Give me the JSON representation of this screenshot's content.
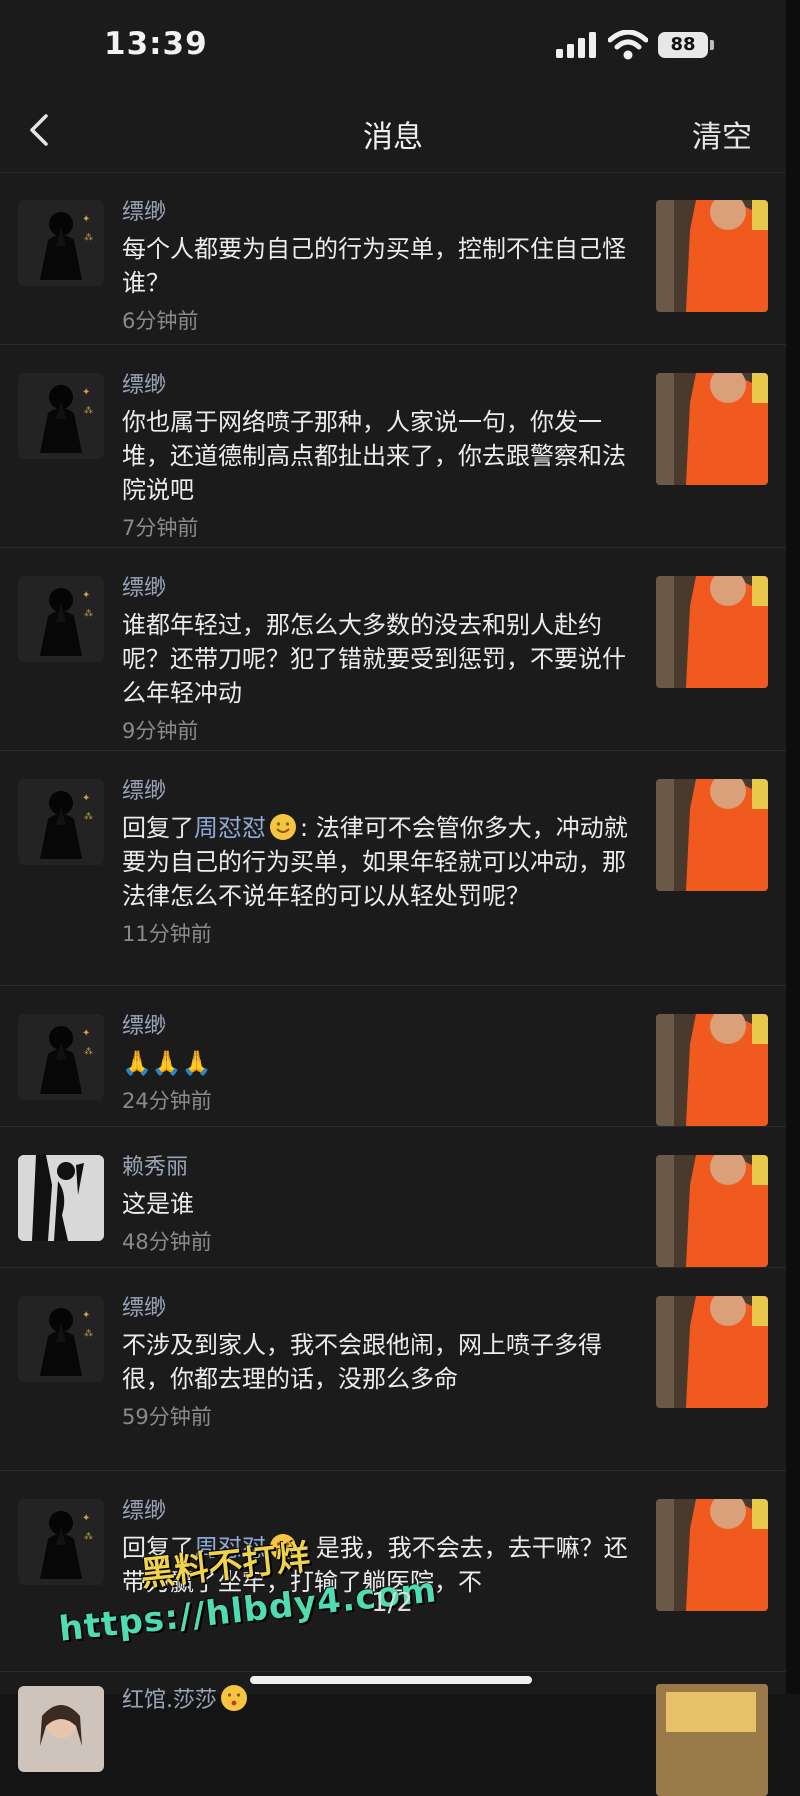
{
  "status_bar": {
    "time": "13:39",
    "battery": "88"
  },
  "nav": {
    "title": "消息",
    "clear_label": "清空"
  },
  "messages": [
    {
      "name": "缥缈",
      "text": "每个人都要为自己的行为买单，控制不住自己怪谁？",
      "time": "6分钟前",
      "avatar": "praying-hands-avatar"
    },
    {
      "name": "缥缈",
      "text": "你也属于网络喷子那种，人家说一句，你发一堆，还道德制高点都扯出来了，你去跟警察和法院说吧",
      "time": "7分钟前",
      "avatar": "praying-hands-avatar"
    },
    {
      "name": "缥缈",
      "text": "谁都年轻过，那怎么大多数的没去和别人赴约呢？还带刀呢？犯了错就要受到惩罚，不要说什么年轻冲动",
      "time": "9分钟前",
      "avatar": "praying-hands-avatar"
    },
    {
      "name": "缥缈",
      "reply_prefix": "回复了",
      "reply_to": "周怼怼",
      "text": ": 法律可不会管你多大，冲动就要为自己的行为买单，如果年轻就可以冲动，那法律怎么不说年轻的可以从轻处罚呢？",
      "time": "11分钟前",
      "avatar": "praying-hands-avatar"
    },
    {
      "name": "缥缈",
      "text": "🙏🙏🙏",
      "time": "24分钟前",
      "avatar": "praying-hands-avatar"
    },
    {
      "name": "赖秀丽",
      "text": "这是谁",
      "time": "48分钟前",
      "avatar": "silhouette-avatar"
    },
    {
      "name": "缥缈",
      "text": "不涉及到家人，我不会跟他闹，网上喷子多得很，你都去理的话，没那么多命",
      "time": "59分钟前",
      "avatar": "praying-hands-avatar"
    },
    {
      "name": "缥缈",
      "reply_prefix": "回复了",
      "reply_to": "周怼怼",
      "text": ": 是我，我不会去，去干嘛？还带刀赢了坐牢，打输了躺医院，不",
      "time": "",
      "avatar": "praying-hands-avatar"
    },
    {
      "name": "红馆.莎莎",
      "text": "",
      "time": "",
      "avatar": "woman-avatar"
    }
  ],
  "pager": "1/2",
  "watermark": {
    "line1": "黑料不打烊",
    "line2": "https://hlbdy4.com"
  },
  "colors": {
    "background": "#1b1b1b",
    "mention": "#8fa8d6",
    "thumbnail_orange": "#f05a1e"
  }
}
